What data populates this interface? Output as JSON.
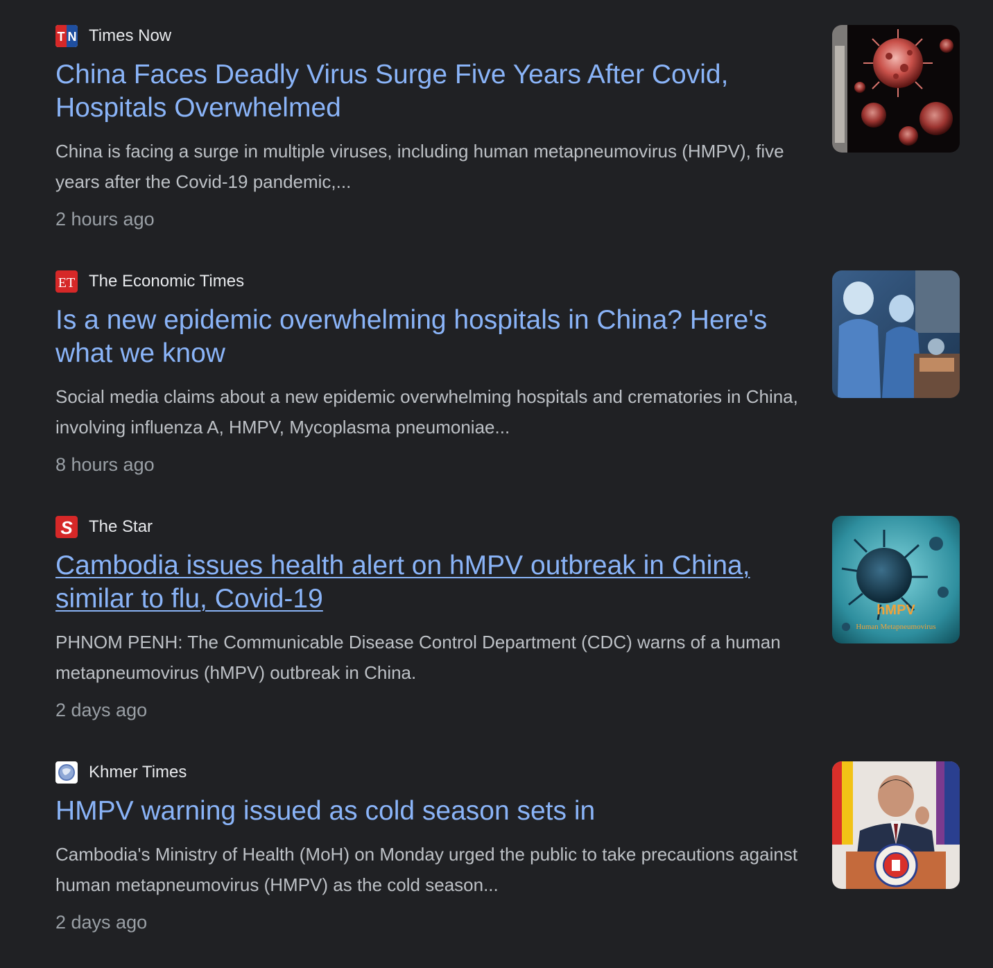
{
  "articles": [
    {
      "source": "Times Now",
      "favicon": {
        "icon": "times-now-logo",
        "text": "TN",
        "color": "#d62828"
      },
      "title": "China Faces Deadly Virus Surge Five Years After Covid, Hospitals Overwhelmed",
      "snippet": "China is facing a surge in multiple viruses, including human metapneumovirus (HMPV), five years after the Covid-19 pandemic,...",
      "time": "2 hours ago",
      "thumbnail": "virus-particles-image"
    },
    {
      "source": "The Economic Times",
      "favicon": {
        "icon": "economic-times-logo",
        "text": "ET",
        "color": "#d62828"
      },
      "title": "Is a new epidemic overwhelming hospitals in China? Here's what we know",
      "snippet": "Social media claims about a new epidemic overwhelming hospitals and crematories in China, involving influenza A, HMPV, Mycoplasma pneumoniae...",
      "time": "8 hours ago",
      "thumbnail": "hospital-workers-image"
    },
    {
      "source": "The Star",
      "favicon": {
        "icon": "the-star-logo",
        "text": "S",
        "color": "#d62828"
      },
      "title": "Cambodia issues health alert on hMPV outbreak in China, similar to flu, Covid-19",
      "snippet": "PHNOM PENH: The Communicable Disease Control Department (CDC) warns of a human metapneumovirus (hMPV) outbreak in China.",
      "time": "2 days ago",
      "thumbnail": "hmpv-virus-image",
      "thumbnail_text": {
        "title": "hMPV",
        "subtitle": "Human Metapneumovirus"
      }
    },
    {
      "source": "Khmer Times",
      "favicon": {
        "icon": "globe-icon"
      },
      "title": "HMPV warning issued as cold season sets in",
      "snippet": "Cambodia's Ministry of Health (MoH) on Monday urged the public to take precautions against human metapneumovirus (HMPV) as the cold season...",
      "time": "2 days ago",
      "thumbnail": "official-at-podium-image"
    }
  ],
  "colors": {
    "background": "#202124",
    "title_link": "#8ab4f8",
    "source_text": "#e8eaed",
    "snippet_text": "#bdc1c6",
    "time_text": "#9aa0a6"
  }
}
